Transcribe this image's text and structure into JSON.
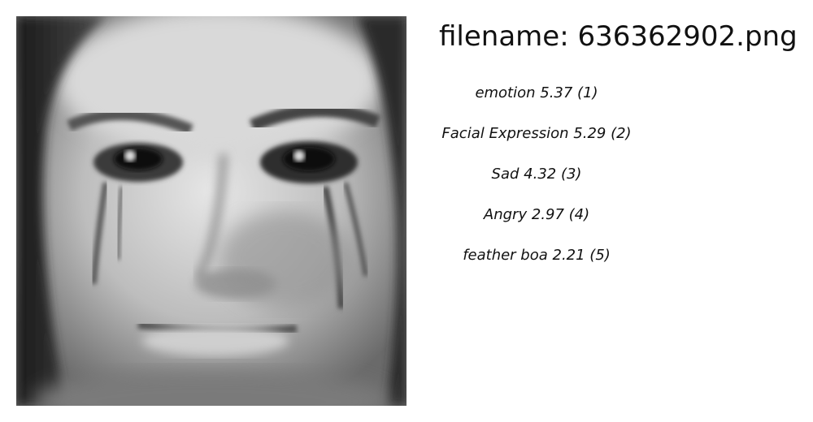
{
  "title": "filename: 636362902.png",
  "labels": [
    {
      "text": "emotion  5.37 (1)"
    },
    {
      "text": "Facial Expression  5.29 (2)"
    },
    {
      "text": "Sad  4.32 (3)"
    },
    {
      "text": "Angry  2.97 (4)"
    },
    {
      "text": "feather boa  2.21 (5)"
    }
  ]
}
